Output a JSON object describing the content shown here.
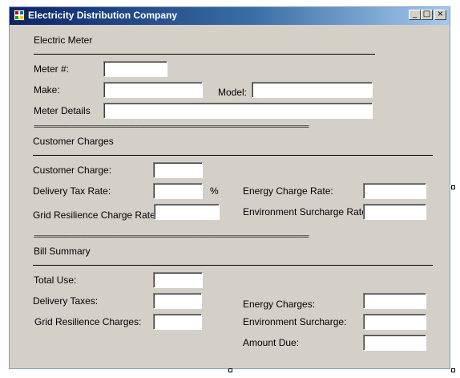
{
  "window": {
    "title": "Electricity Distribution Company",
    "buttons": {
      "minimize": "_",
      "maximize": "□",
      "close": "×"
    }
  },
  "meter": {
    "heading": "Electric Meter",
    "meter_label": "Meter #:",
    "make_label": "Make:",
    "model_label": "Model:",
    "details_label": "Meter Details",
    "meter_value": "",
    "make_value": "",
    "model_value": "",
    "details_value": ""
  },
  "separator": "===========================================================================================",
  "charges": {
    "heading": "Customer Charges",
    "customer_charge_label": "Customer Charge:",
    "delivery_tax_label": "Delivery Tax Rate:",
    "percent_sign": "%",
    "grid_label": "Grid Resilience Charge Rate:",
    "energy_label": "Energy Charge Rate:",
    "environment_label": "Environment Surcharge Rate:"
  },
  "summary": {
    "heading": "Bill Summary",
    "total_use_label": "Total Use:",
    "delivery_taxes_label": "Delivery Taxes:",
    "grid_label": "Grid Resilience Charges:",
    "energy_label": "Energy Charges:",
    "environment_label": "Environment Surcharge:",
    "amount_due_label": "Amount Due:"
  },
  "colors": {
    "form_bg": "#d4d0c8",
    "title_start": "#0a246a",
    "title_end": "#a6caf0"
  }
}
